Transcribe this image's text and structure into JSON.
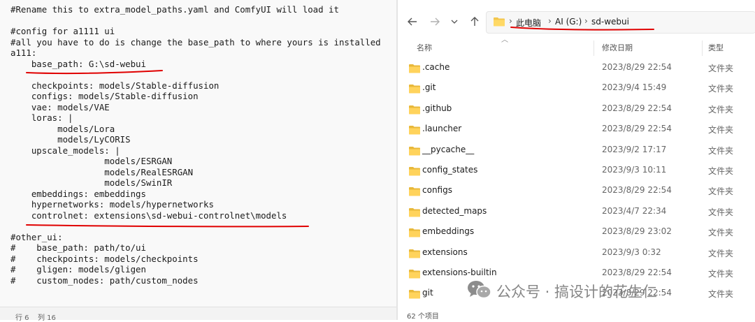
{
  "editor": {
    "lines": [
      "#Rename this to extra_model_paths.yaml and ComfyUI will load it",
      "",
      "#config for a1111 ui",
      "#all you have to do is change the base_path to where yours is installed",
      "a111:",
      "    base_path: G:\\sd-webui",
      "",
      "    checkpoints: models/Stable-diffusion",
      "    configs: models/Stable-diffusion",
      "    vae: models/VAE",
      "    loras: |",
      "         models/Lora",
      "         models/LyCORIS",
      "    upscale_models: |",
      "                  models/ESRGAN",
      "                  models/RealESRGAN",
      "                  models/SwinIR",
      "    embeddings: embeddings",
      "    hypernetworks: models/hypernetworks",
      "    controlnet: extensions\\sd-webui-controlnet\\models",
      "",
      "#other_ui:",
      "#    base_path: path/to/ui",
      "#    checkpoints: models/checkpoints",
      "#    gligen: models/gligen",
      "#    custom_nodes: path/custom_nodes"
    ],
    "status_line": "行 6",
    "status_col": "列 16"
  },
  "explorer": {
    "breadcrumb": [
      "此电脑",
      "AI (G:)",
      "sd-webui"
    ],
    "columns": {
      "name": "名称",
      "date": "修改日期",
      "type": "类型"
    },
    "rows": [
      {
        "name": ".cache",
        "date": "2023/8/29 22:54",
        "type": "文件夹"
      },
      {
        "name": ".git",
        "date": "2023/9/4 15:49",
        "type": "文件夹"
      },
      {
        "name": ".github",
        "date": "2023/8/29 22:54",
        "type": "文件夹"
      },
      {
        "name": ".launcher",
        "date": "2023/8/29 22:54",
        "type": "文件夹"
      },
      {
        "name": "__pycache__",
        "date": "2023/9/2 17:17",
        "type": "文件夹"
      },
      {
        "name": "config_states",
        "date": "2023/9/3 10:11",
        "type": "文件夹"
      },
      {
        "name": "configs",
        "date": "2023/8/29 22:54",
        "type": "文件夹"
      },
      {
        "name": "detected_maps",
        "date": "2023/4/7 22:34",
        "type": "文件夹"
      },
      {
        "name": "embeddings",
        "date": "2023/8/29 23:02",
        "type": "文件夹"
      },
      {
        "name": "extensions",
        "date": "2023/9/3 0:32",
        "type": "文件夹"
      },
      {
        "name": "extensions-builtin",
        "date": "2023/8/29 22:54",
        "type": "文件夹"
      },
      {
        "name": "git",
        "date": "2023/8/29 22:54",
        "type": "文件夹"
      }
    ],
    "status": "62 个项目"
  },
  "watermark": "公众号 · 搞设计的花生仁",
  "colors": {
    "annotation_red": "#e00000",
    "folder_yellow": "#f3c64d"
  }
}
